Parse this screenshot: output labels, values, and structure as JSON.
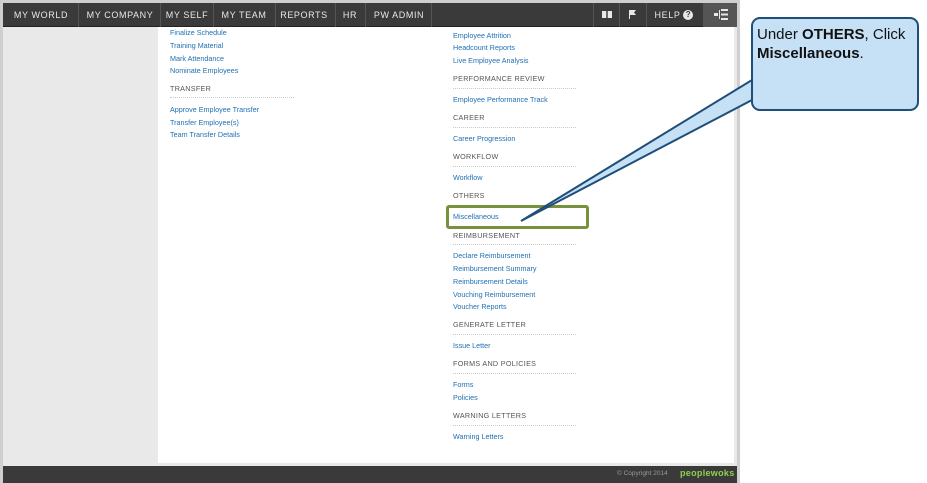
{
  "nav": {
    "items": [
      "MY WORLD",
      "MY COMPANY",
      "MY SELF",
      "MY TEAM",
      "REPORTS",
      "HR",
      "PW ADMIN"
    ],
    "help_label": "HELP",
    "help_glyph": "?"
  },
  "left_column": {
    "top_links": [
      "Finalize Schedule",
      "Training Material",
      "Mark Attendance",
      "Nominate Employees"
    ],
    "transfer_heading": "TRANSFER",
    "transfer_links": [
      "Approve Employee Transfer",
      "Transfer Employee(s)",
      "Team Transfer Details"
    ]
  },
  "right_column": {
    "top_links": [
      "Employee Attrition",
      "Headcount Reports",
      "Live Employee Analysis"
    ],
    "performance_heading": "PERFORMANCE REVIEW",
    "performance_links": [
      "Employee Performance Track"
    ],
    "career_heading": "CAREER",
    "career_links": [
      "Career Progression"
    ],
    "workflow_heading": "WORKFLOW",
    "workflow_links": [
      "Workflow"
    ],
    "others_heading": "OTHERS",
    "others_links": [
      "Miscellaneous"
    ],
    "reimbursement_heading": "REIMBURSEMENT",
    "reimbursement_links": [
      "Declare Reimbursement",
      "Reimbursement Summary",
      "Reimbursement Details",
      "Vouching Reimbursement",
      "Voucher Reports"
    ],
    "generate_letter_heading": "GENERATE LETTER",
    "generate_letter_links": [
      "Issue Letter"
    ],
    "forms_heading": "FORMS AND POLICIES",
    "forms_links": [
      "Forms",
      "Policies"
    ],
    "warning_heading": "WARNING LETTERS",
    "warning_links": [
      "Warning Letters"
    ]
  },
  "footer": {
    "copyright": "© Copyright 2014",
    "brand": "peoplewoks"
  },
  "callout": {
    "pre": "Under ",
    "bold1": "OTHERS",
    "mid": ", Click ",
    "bold2": "Miscellaneous",
    "post": "."
  },
  "colors": {
    "nav_bg": "#3a3a3a",
    "link": "#1f6fb3",
    "highlight": "#76923c",
    "callout_fill": "#c6e0f5",
    "callout_border": "#1f4e79",
    "brand": "#8fd14f"
  },
  "icons": [
    "book-icon",
    "flag-icon",
    "help-icon",
    "menu-tree-icon"
  ]
}
